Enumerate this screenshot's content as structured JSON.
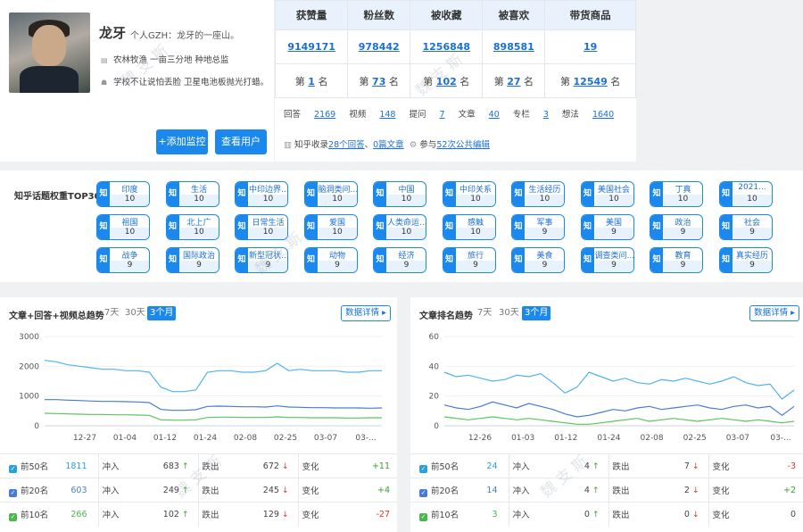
{
  "profile": {
    "name": "龙牙",
    "slogan": "个人GZH：龙牙的一座山。",
    "line1": "农林牧渔   一亩三分地  种地总监",
    "line2": "学校不让说怕丢脸 卫星电池板抛光打蜡。",
    "add_btn": "+添加监控",
    "view_btn": "查看用户"
  },
  "stats": {
    "headers": [
      "获赞量",
      "粉丝数",
      "被收藏",
      "被喜欢",
      "带货商品"
    ],
    "values": [
      "9149171",
      "978442",
      "1256848",
      "898581",
      "19"
    ],
    "rank_prefix": "第",
    "rank_suffix": "名",
    "ranks": [
      "1",
      "73",
      "102",
      "27",
      "12549"
    ],
    "counts": [
      {
        "label": "回答",
        "value": "2169"
      },
      {
        "label": "视频",
        "value": "148"
      },
      {
        "label": "提问",
        "value": "7"
      },
      {
        "label": "文章",
        "value": "40"
      },
      {
        "label": "专栏",
        "value": "3"
      },
      {
        "label": "想法",
        "value": "1640"
      }
    ],
    "misc": {
      "a": "知乎收录",
      "b": "28个回答",
      "c": "、",
      "d": "0篇文章",
      "e": "参与",
      "f": "52次公共编辑"
    }
  },
  "topics": {
    "title": "知乎话题权重TOP30",
    "prefix": "知",
    "items": [
      {
        "name": "印度",
        "value": "10"
      },
      {
        "name": "生活",
        "value": "10"
      },
      {
        "name": "中印边界...",
        "value": "10"
      },
      {
        "name": "脑洞类问...",
        "value": "10"
      },
      {
        "name": "中国",
        "value": "10"
      },
      {
        "name": "中印关系",
        "value": "10"
      },
      {
        "name": "生活经历",
        "value": "10"
      },
      {
        "name": "美国社会",
        "value": "10"
      },
      {
        "name": "丁真",
        "value": "10"
      },
      {
        "name": "2021...",
        "value": "10"
      },
      {
        "name": "祖国",
        "value": "10"
      },
      {
        "name": "北上广",
        "value": "10"
      },
      {
        "name": "日常生活",
        "value": "10"
      },
      {
        "name": "爱国",
        "value": "10"
      },
      {
        "name": "人类命运...",
        "value": "10"
      },
      {
        "name": "感触",
        "value": "10"
      },
      {
        "name": "军事",
        "value": "9"
      },
      {
        "name": "美国",
        "value": "9"
      },
      {
        "name": "政治",
        "value": "9"
      },
      {
        "name": "社会",
        "value": "9"
      },
      {
        "name": "战争",
        "value": "9"
      },
      {
        "name": "国际政治",
        "value": "9"
      },
      {
        "name": "新型冠状...",
        "value": "9"
      },
      {
        "name": "动物",
        "value": "9"
      },
      {
        "name": "经济",
        "value": "9"
      },
      {
        "name": "旅行",
        "value": "9"
      },
      {
        "name": "美食",
        "value": "9"
      },
      {
        "name": "调查类问...",
        "value": "9"
      },
      {
        "name": "教育",
        "value": "9"
      },
      {
        "name": "真实经历",
        "value": "9"
      }
    ]
  },
  "panels": [
    {
      "title": "文章+回答+视频总趋势",
      "ranges": [
        "7天",
        "30天",
        "3个月"
      ],
      "detail": "数据详情",
      "rows": [
        {
          "name": "前50名",
          "total": "1811",
          "in_label": "冲入",
          "in": "683",
          "out_label": "跌出",
          "out": "672",
          "change_label": "变化",
          "change": "+11",
          "color": "#29a0e0"
        },
        {
          "name": "前20名",
          "total": "603",
          "in_label": "冲入",
          "in": "249",
          "out_label": "跌出",
          "out": "245",
          "change_label": "变化",
          "change": "+4",
          "color": "#4a7bd4"
        },
        {
          "name": "前10名",
          "total": "266",
          "in_label": "冲入",
          "in": "102",
          "out_label": "跌出",
          "out": "129",
          "change_label": "变化",
          "change": "-27",
          "color": "#4bb84b"
        }
      ]
    },
    {
      "title": "文章排名趋势",
      "ranges": [
        "7天",
        "30天",
        "3个月"
      ],
      "detail": "数据详情",
      "rows": [
        {
          "name": "前50名",
          "total": "24",
          "in_label": "冲入",
          "in": "4",
          "out_label": "跌出",
          "out": "7",
          "change_label": "变化",
          "change": "-3",
          "color": "#29a0e0"
        },
        {
          "name": "前20名",
          "total": "14",
          "in_label": "冲入",
          "in": "4",
          "out_label": "跌出",
          "out": "2",
          "change_label": "变化",
          "change": "+2",
          "color": "#4a7bd4"
        },
        {
          "name": "前10名",
          "total": "3",
          "in_label": "冲入",
          "in": "0",
          "out_label": "跌出",
          "out": "0",
          "change_label": "变化",
          "change": "0",
          "color": "#4bb84b"
        }
      ]
    }
  ],
  "chart_data": [
    {
      "type": "line",
      "x_ticks": [
        "12-27",
        "01-04",
        "01-12",
        "01-24",
        "02-08",
        "02-25",
        "03-07",
        "03-..."
      ],
      "y_ticks": [
        "0",
        "1000",
        "2000",
        "3000"
      ],
      "ylim": [
        0,
        3000
      ],
      "series": [
        {
          "name": "前50名",
          "color": "#52b3ec",
          "values": [
            2200,
            2150,
            2050,
            2000,
            1950,
            1900,
            1900,
            1850,
            1850,
            1800,
            1300,
            1150,
            1150,
            1200,
            1800,
            1850,
            1850,
            1800,
            1800,
            1850,
            2100,
            1850,
            1900,
            1850,
            1850,
            1850,
            1800,
            1800,
            1850,
            1850
          ]
        },
        {
          "name": "前20名",
          "color": "#4a7bd4",
          "values": [
            880,
            880,
            860,
            850,
            830,
            820,
            820,
            810,
            800,
            780,
            550,
            520,
            520,
            540,
            650,
            660,
            650,
            640,
            640,
            630,
            670,
            630,
            620,
            610,
            610,
            600,
            600,
            600,
            590,
            600
          ]
        },
        {
          "name": "前10名",
          "color": "#5cc45c",
          "values": [
            420,
            410,
            400,
            390,
            380,
            380,
            370,
            370,
            360,
            350,
            200,
            190,
            190,
            200,
            280,
            290,
            290,
            280,
            280,
            280,
            300,
            280,
            280,
            270,
            270,
            270,
            260,
            260,
            270,
            270
          ]
        }
      ]
    },
    {
      "type": "line",
      "x_ticks": [
        "12-26",
        "01-03",
        "01-12",
        "01-24",
        "02-08",
        "02-25",
        "03-07",
        "03-..."
      ],
      "y_ticks": [
        "0",
        "20",
        "40",
        "60"
      ],
      "ylim": [
        0,
        60
      ],
      "series": [
        {
          "name": "前50名",
          "color": "#52b3ec",
          "values": [
            36,
            33,
            34,
            32,
            30,
            31,
            34,
            33,
            35,
            29,
            22,
            26,
            36,
            33,
            30,
            32,
            29,
            28,
            31,
            30,
            32,
            30,
            28,
            30,
            33,
            29,
            27,
            28,
            18,
            24
          ]
        },
        {
          "name": "前20名",
          "color": "#4a7bd4",
          "values": [
            14,
            12,
            11,
            13,
            16,
            14,
            12,
            15,
            13,
            11,
            8,
            6,
            7,
            9,
            11,
            10,
            12,
            13,
            11,
            12,
            13,
            14,
            12,
            11,
            13,
            14,
            12,
            13,
            7,
            13
          ]
        },
        {
          "name": "前10名",
          "color": "#5cc45c",
          "values": [
            6,
            5,
            4,
            5,
            6,
            5,
            4,
            5,
            4,
            3,
            2,
            1,
            1,
            2,
            3,
            4,
            5,
            3,
            4,
            5,
            4,
            3,
            4,
            5,
            4,
            3,
            4,
            3,
            2,
            3
          ]
        }
      ]
    }
  ]
}
